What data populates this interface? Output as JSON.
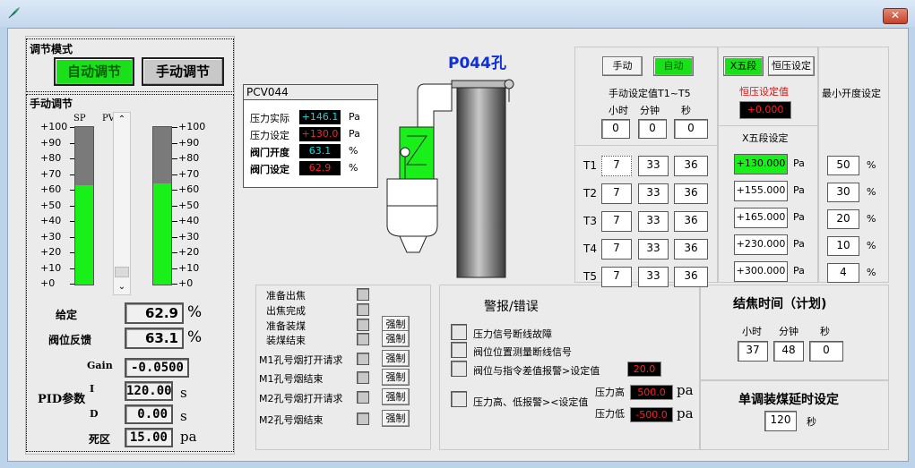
{
  "window": {
    "icon": "feather-icon",
    "close_symbol": "✕"
  },
  "mode": {
    "title": "调节模式",
    "auto_label": "自动调节",
    "manual_label": "手动调节",
    "manual_adjust_title": "手动调节",
    "sp_label": "SP",
    "pv_label": "PV",
    "scale": [
      "+100",
      "+90",
      "+80",
      "+70",
      "+60",
      "+50",
      "+40",
      "+30",
      "+20",
      "+10",
      "+0"
    ],
    "sp_level": 0.63,
    "pv_level": 0.64
  },
  "gauges": {
    "setpoint_label": "给定",
    "setpoint_value": "62.9",
    "setpoint_unit": "%",
    "feedback_label": "阀位反馈",
    "feedback_value": "63.1",
    "feedback_unit": "%"
  },
  "pid": {
    "title": "PID参数",
    "gain_label": "Gain",
    "gain_value": "-0.0500",
    "i_label": "I",
    "i_value": "120.00",
    "i_unit": "s",
    "d_label": "D",
    "d_value": "0.00",
    "d_unit": "s",
    "dead_label": "死区",
    "dead_value": "15.00",
    "dead_unit": "pa"
  },
  "pcv": {
    "title": "PCV044",
    "rows": [
      {
        "label": "压力实际",
        "value": "+146.1",
        "unit": "Pa",
        "color": "#00e0e0"
      },
      {
        "label": "压力设定",
        "value": "+130.0",
        "unit": "Pa",
        "color": "#ff2020"
      },
      {
        "label": "阀门开度",
        "value": "63.1",
        "unit": "%",
        "color": "#00e0e0"
      },
      {
        "label": "阀门设定",
        "value": "62.9",
        "unit": "%",
        "color": "#ff2020"
      }
    ]
  },
  "header": {
    "hole_title": "P044孔"
  },
  "timer": {
    "manual_label": "手动",
    "auto_label": "自动",
    "manual_set_title": "手动设定值T1~T5",
    "col_hour": "小时",
    "col_min": "分钟",
    "col_sec": "秒",
    "manual_values": [
      "0",
      "0",
      "0"
    ],
    "rows": [
      {
        "label": "T1",
        "h": "7",
        "m": "33",
        "s": "36"
      },
      {
        "label": "T2",
        "h": "7",
        "m": "33",
        "s": "36"
      },
      {
        "label": "T3",
        "h": "7",
        "m": "33",
        "s": "36"
      },
      {
        "label": "T4",
        "h": "7",
        "m": "33",
        "s": "36"
      },
      {
        "label": "T5",
        "h": "7",
        "m": "33",
        "s": "36"
      }
    ]
  },
  "xfive": {
    "xfive_label": "X五段",
    "const_label": "恒压设定",
    "const_value_title": "恒压设定值",
    "const_value": "+0.000",
    "section_title": "X五段设定",
    "values": [
      "+130.000",
      "+155.000",
      "+165.000",
      "+230.000",
      "+300.000"
    ],
    "unit": "Pa"
  },
  "min_open": {
    "title": "最小开度设定",
    "values": [
      "50",
      "30",
      "20",
      "10",
      "4"
    ],
    "unit": "%"
  },
  "signals": {
    "items": [
      {
        "label": "准备出焦",
        "force": ""
      },
      {
        "label": "出焦完成",
        "force": ""
      },
      {
        "label": "准备装煤",
        "force": "强制"
      },
      {
        "label": "装煤结束",
        "force": "强制"
      },
      {
        "label": "M1孔号烟打开请求",
        "force": "强制"
      },
      {
        "label": "M1孔号烟结束",
        "force": "强制"
      },
      {
        "label": "M2孔号烟打开请求",
        "force": "强制"
      },
      {
        "label": "M2孔号烟结束",
        "force": "强制"
      }
    ]
  },
  "alarm": {
    "title": "警报/错误",
    "items": [
      "压力信号断线故障",
      "阀位位置测量断线信号",
      "阀位与指令差值报警>设定值",
      "压力高、低报警><设定值"
    ],
    "diff_value": "20.0",
    "high_label": "压力高",
    "high_value": "500.0",
    "high_unit": "pa",
    "low_label": "压力低",
    "low_value": "-500.0",
    "low_unit": "pa"
  },
  "coke": {
    "title": "结焦时间（计划)",
    "col_hour": "小时",
    "col_min": "分钟",
    "col_sec": "秒",
    "values": [
      "37",
      "48",
      "0"
    ]
  },
  "delay": {
    "title": "单调装煤延时设定",
    "value": "120",
    "unit": "秒"
  }
}
